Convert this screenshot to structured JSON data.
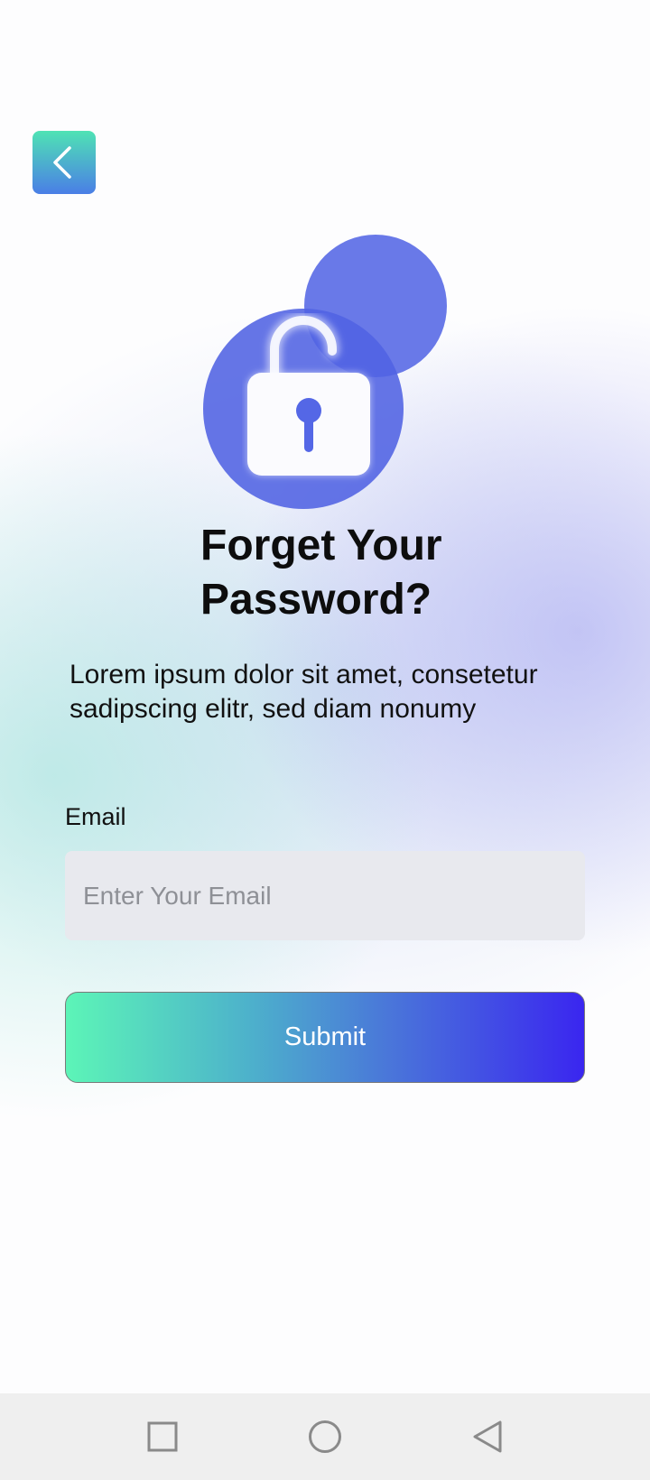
{
  "header": {
    "back_icon": "chevron-left-icon",
    "back_gradient": [
      "#4fe3b4",
      "#4a7ee6"
    ]
  },
  "hero": {
    "icon": "unlocked-padlock-icon",
    "accent": "#5062e2"
  },
  "main": {
    "title_line1": "Forget Your",
    "title_line2": "Password?",
    "subtitle_line1": "Lorem ipsum dolor sit amet, consetetur",
    "subtitle_line2": "sadipscing elitr, sed diam nonumy"
  },
  "form": {
    "email_label": "Email",
    "email_placeholder": "Enter Your Email",
    "email_value": "",
    "submit_label": "Submit",
    "submit_gradient": [
      "#5cf5b7",
      "#3a26f0"
    ]
  },
  "nav_bar": {
    "recents_icon": "square-icon",
    "home_icon": "circle-icon",
    "back_icon": "triangle-back-icon"
  }
}
